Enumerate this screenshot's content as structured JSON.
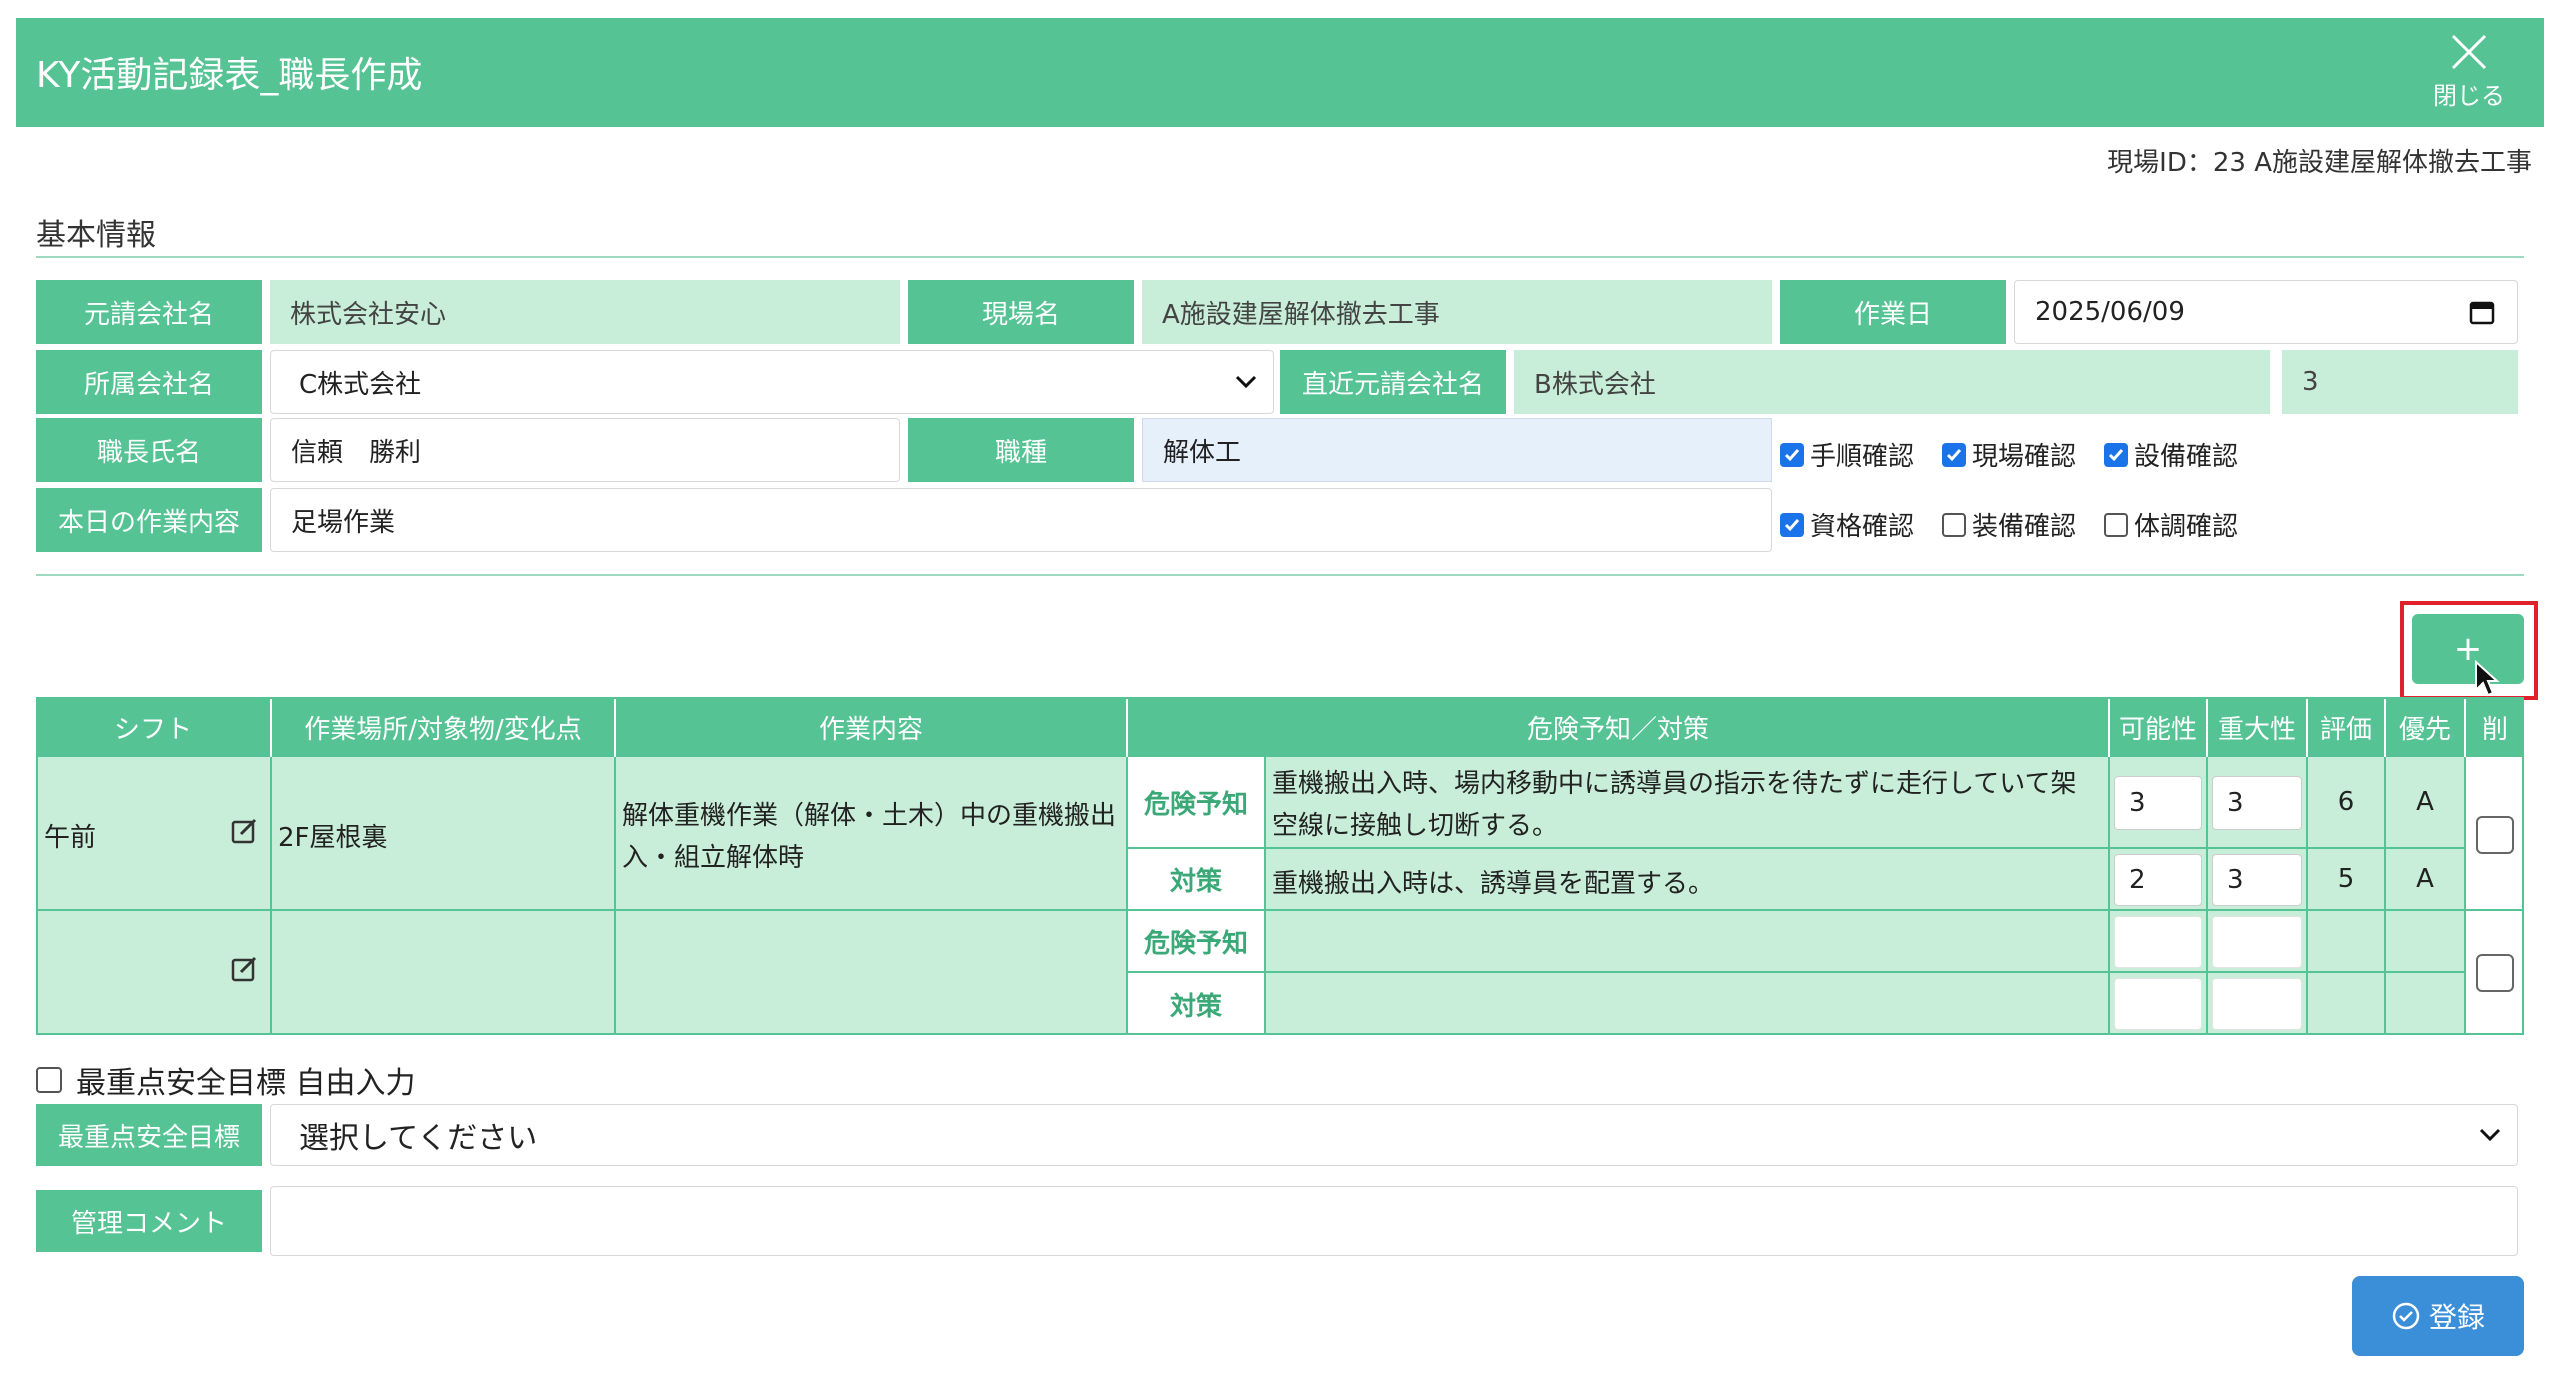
{
  "header": {
    "title": "KY活動記録表_職長作成",
    "close_label": "閉じる"
  },
  "site_id_text": "現場ID：23 A施設建屋解体撤去工事",
  "basic_info": {
    "section_title": "基本情報",
    "prime_company_label": "元請会社名",
    "prime_company_value": "株式会社安心",
    "site_name_label": "現場名",
    "site_name_value": "A施設建屋解体撤去工事",
    "work_date_label": "作業日",
    "work_date_value": "2025/06/09",
    "affiliation_label": "所属会社名",
    "affiliation_value": "C株式会社",
    "direct_prime_label": "直近元請会社名",
    "direct_prime_value": "B株式会社",
    "direct_prime_extra": "3",
    "foreman_label": "職長氏名",
    "foreman_value": "信頼　勝利",
    "job_type_label": "職種",
    "job_type_value": "解体工",
    "todays_work_label": "本日の作業内容",
    "todays_work_value": "足場作業",
    "checks": [
      {
        "label": "手順確認",
        "checked": true
      },
      {
        "label": "現場確認",
        "checked": true
      },
      {
        "label": "設備確認",
        "checked": true
      },
      {
        "label": "資格確認",
        "checked": true
      },
      {
        "label": "装備確認",
        "checked": false
      },
      {
        "label": "体調確認",
        "checked": false
      }
    ]
  },
  "add_button_label": "+",
  "table": {
    "headers": [
      "シフト",
      "作業場所/対象物/変化点",
      "作業内容",
      "危険予知／対策",
      "可能性",
      "重大性",
      "評価",
      "優先",
      "削"
    ],
    "rows": [
      {
        "shift": "午前",
        "place": "2F屋根裏",
        "work": "解体重機作業（解体・土木）中の重機搬出入・組立解体時",
        "hazard_label": "危険予知",
        "hazard_text": "重機搬出入時、場内移動中に誘導員の指示を待たずに走行していて架空線に接触し切断する。",
        "hazard_possibility": "3",
        "hazard_severity": "3",
        "hazard_eval": "6",
        "hazard_priority": "A",
        "measure_label": "対策",
        "measure_text": "重機搬出入時は、誘導員を配置する。",
        "measure_possibility": "2",
        "measure_severity": "3",
        "measure_eval": "5",
        "measure_priority": "A"
      },
      {
        "shift": "",
        "place": "",
        "work": "",
        "hazard_label": "危険予知",
        "hazard_text": "",
        "measure_label": "対策",
        "measure_text": ""
      }
    ]
  },
  "free_input_label": "最重点安全目標 自由入力",
  "goal_label": "最重点安全目標",
  "goal_select_value": "選択してください",
  "comment_label": "管理コメント",
  "comment_value": "",
  "submit_label": "登録"
}
